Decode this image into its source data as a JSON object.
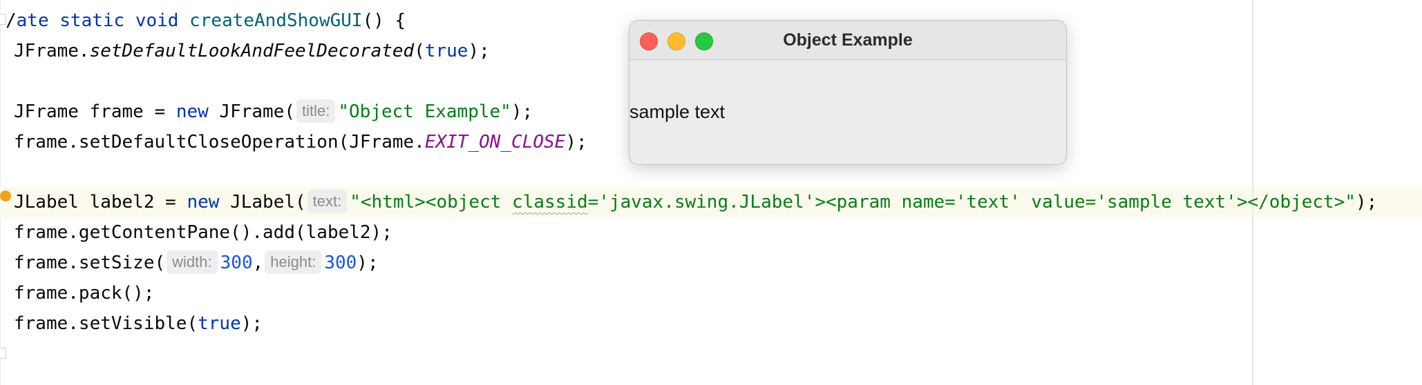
{
  "code": {
    "line1": {
      "fragment": "/",
      "kw": "ate static void ",
      "fn": "createAndShowGUI",
      "rest": "() {"
    },
    "line2": {
      "a": "JFrame.",
      "method": "setDefaultLookAndFeelDecorated",
      "b": "(",
      "kw": "true",
      "c": ");"
    },
    "line4": {
      "a": "JFrame frame = ",
      "kw": "new",
      "b": " JFrame(",
      "hint": "title:",
      "str": "\"Object Example\"",
      "c": ");"
    },
    "line5": {
      "a": "frame.setDefaultCloseOperation(JFrame.",
      "const": "EXIT_ON_CLOSE",
      "b": ");"
    },
    "line7": {
      "a": "JLabel label2 = ",
      "kw": "new",
      "b": " JLabel(",
      "hint": "text:",
      "str1": "\"<html><object ",
      "str_squiggle": "classid",
      "str2": "='javax.swing.JLabel'><param name='text' value='sample text'></object>\"",
      "c": ");"
    },
    "line8": {
      "a": "frame.getContentPane().add(label2);"
    },
    "line9": {
      "a": "frame.setSize(",
      "hint_w": "width:",
      "num_w": "300",
      "comma": ",",
      "hint_h": "height:",
      "num_h": "300",
      "c": ");"
    },
    "line10": {
      "a": "frame.pack();"
    },
    "line11": {
      "a": "frame.setVisible(",
      "kw": "true",
      "c": ");"
    }
  },
  "window": {
    "title": "Object Example",
    "label": "sample text"
  },
  "colors": {
    "keyword": "#0033b3",
    "string": "#067d17",
    "number": "#1750eb",
    "constant": "#871094",
    "close": "#ff5f57",
    "minimize": "#febc2e",
    "maximize": "#28c840"
  }
}
